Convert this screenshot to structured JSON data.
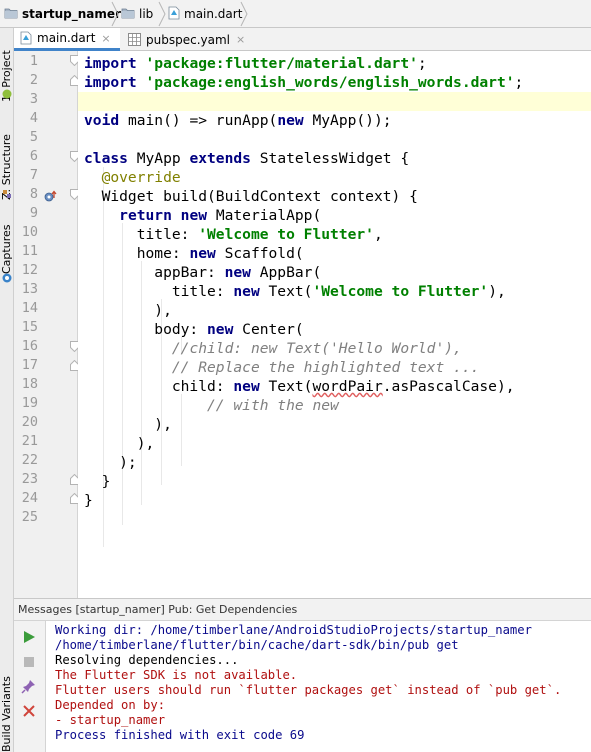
{
  "breadcrumbs": [
    {
      "label": "startup_namer",
      "icon": "folder-icon"
    },
    {
      "label": "lib",
      "icon": "folder-icon"
    },
    {
      "label": "main.dart",
      "icon": "dart-file-icon"
    }
  ],
  "sidebar": {
    "project_tab": "1: Project",
    "structure_tab": "Z: Structure",
    "captures_tab": "Captures",
    "build_variants_tab": "Build Variants"
  },
  "tabs": [
    {
      "label": "main.dart",
      "icon": "dart-file-icon",
      "close": "×",
      "active": true
    },
    {
      "label": "pubspec.yaml",
      "icon": "yaml-file-icon",
      "close": "×",
      "active": false
    }
  ],
  "editor": {
    "current_line": 3,
    "line_numbers": [
      "1",
      "2",
      "3",
      "4",
      "5",
      "6",
      "7",
      "8",
      "9",
      "10",
      "11",
      "12",
      "13",
      "14",
      "15",
      "16",
      "17",
      "18",
      "19",
      "20",
      "21",
      "22",
      "23",
      "24",
      "25"
    ],
    "lines": [
      [
        [
          "kw",
          "import"
        ],
        [
          "p",
          " "
        ],
        [
          "str",
          "'package:flutter/material.dart'"
        ],
        [
          "p",
          ";"
        ]
      ],
      [
        [
          "kw",
          "import"
        ],
        [
          "p",
          " "
        ],
        [
          "str",
          "'package:english_words/english_words.dart'"
        ],
        [
          "p",
          ";"
        ]
      ],
      [],
      [
        [
          "kw",
          "void"
        ],
        [
          "p",
          " main() => runApp("
        ],
        [
          "kw",
          "new"
        ],
        [
          "p",
          " MyApp());"
        ]
      ],
      [],
      [
        [
          "kw",
          "class"
        ],
        [
          "p",
          " MyApp "
        ],
        [
          "kw",
          "extends"
        ],
        [
          "p",
          " StatelessWidget {"
        ]
      ],
      [
        [
          "p",
          "  "
        ],
        [
          "ann",
          "@override"
        ]
      ],
      [
        [
          "p",
          "  Widget build(BuildContext context) {"
        ]
      ],
      [
        [
          "p",
          "    "
        ],
        [
          "kw",
          "return"
        ],
        [
          "p",
          " "
        ],
        [
          "kw",
          "new"
        ],
        [
          "p",
          " MaterialApp("
        ]
      ],
      [
        [
          "p",
          "      title: "
        ],
        [
          "str",
          "'Welcome to Flutter'"
        ],
        [
          "p",
          ","
        ]
      ],
      [
        [
          "p",
          "      home: "
        ],
        [
          "kw",
          "new"
        ],
        [
          "p",
          " Scaffold("
        ]
      ],
      [
        [
          "p",
          "        appBar: "
        ],
        [
          "kw",
          "new"
        ],
        [
          "p",
          " AppBar("
        ]
      ],
      [
        [
          "p",
          "          title: "
        ],
        [
          "kw",
          "new"
        ],
        [
          "p",
          " Text("
        ],
        [
          "str",
          "'Welcome to Flutter'"
        ],
        [
          "p",
          "),"
        ]
      ],
      [
        [
          "p",
          "        ),"
        ]
      ],
      [
        [
          "p",
          "        body: "
        ],
        [
          "kw",
          "new"
        ],
        [
          "p",
          " Center("
        ]
      ],
      [
        [
          "p",
          "          "
        ],
        [
          "cm",
          "//child: new Text('Hello World'),"
        ]
      ],
      [
        [
          "p",
          "          "
        ],
        [
          "cm",
          "// Replace the highlighted text ..."
        ]
      ],
      [
        [
          "p",
          "          child: "
        ],
        [
          "kw",
          "new"
        ],
        [
          "p",
          " Text("
        ],
        [
          "squig",
          "wordPair"
        ],
        [
          "p",
          ".asPascalCase),"
        ]
      ],
      [
        [
          "p",
          "              "
        ],
        [
          "cm",
          "// with the new"
        ]
      ],
      [
        [
          "p",
          "        ),"
        ]
      ],
      [
        [
          "p",
          "      ),"
        ]
      ],
      [
        [
          "p",
          "    );"
        ]
      ],
      [
        [
          "p",
          "  }"
        ]
      ],
      [
        [
          "p",
          "}"
        ]
      ],
      []
    ]
  },
  "messages": {
    "title": "Messages [startup_namer] Pub: Get Dependencies",
    "lines": [
      {
        "cls": "blue",
        "text": "Working dir: /home/timberlane/AndroidStudioProjects/startup_namer"
      },
      {
        "cls": "blue",
        "text": "/home/timberlane/flutter/bin/cache/dart-sdk/bin/pub get"
      },
      {
        "cls": "black",
        "text": "Resolving dependencies..."
      },
      {
        "cls": "red",
        "text": "The Flutter SDK is not available."
      },
      {
        "cls": "red",
        "text": "Flutter users should run `flutter packages get` instead of `pub get`."
      },
      {
        "cls": "red",
        "text": "Depended on by:"
      },
      {
        "cls": "red",
        "text": "- startup_namer"
      },
      {
        "cls": "blue",
        "text": "Process finished with exit code 69"
      }
    ]
  },
  "colors": {
    "keyword": "#000080",
    "string": "#008000",
    "annotation": "#808000",
    "comment": "#808080",
    "current_line": "#ffffd7",
    "tab_underline": "#4083c9"
  }
}
